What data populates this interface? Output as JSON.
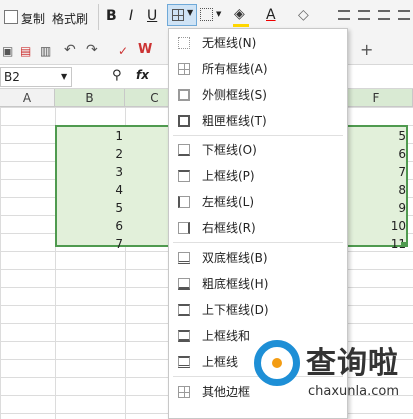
{
  "toolbar": {
    "copy": "复制",
    "format_painter": "格式刷",
    "bold": "B",
    "italic": "I",
    "underline": "U",
    "name_box": "B2",
    "fx": "fx",
    "text_color": "A"
  },
  "columns": [
    "A",
    "B",
    "C",
    "F"
  ],
  "rows_b": [
    "1",
    "2",
    "3",
    "4",
    "5",
    "6",
    "7"
  ],
  "rows_f": [
    "5",
    "6",
    "7",
    "8",
    "9",
    "10",
    "11"
  ],
  "menu": {
    "items": [
      "无框线(N)",
      "所有框线(A)",
      "外侧框线(S)",
      "粗匣框线(T)",
      "下框线(O)",
      "上框线(P)",
      "左框线(L)",
      "右框线(R)",
      "双底框线(B)",
      "粗底框线(H)",
      "上下框线(D)",
      "上框线和",
      "上框线",
      "其他边框"
    ]
  },
  "watermark": {
    "title": "查询啦",
    "url": "chaxunla.com"
  }
}
